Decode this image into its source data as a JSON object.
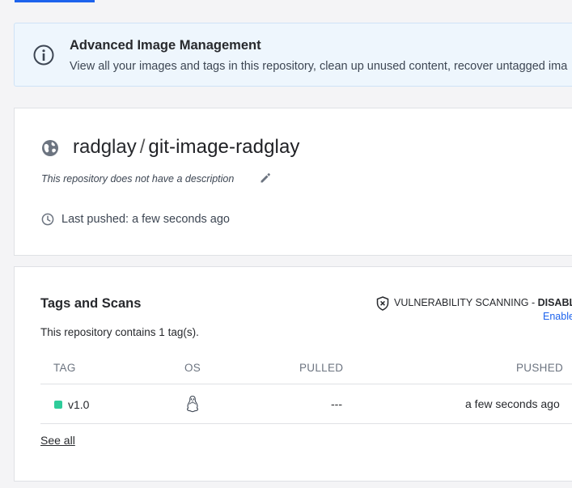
{
  "banner": {
    "title": "Advanced Image Management",
    "description": "View all your images and tags in this repository, clean up unused content, recover untagged ima",
    "icon": "info-icon"
  },
  "repo": {
    "namespace": "radglay",
    "separator": "/",
    "name": "git-image-radglay",
    "description": "This repository does not have a description",
    "last_pushed": "Last pushed: a few seconds ago",
    "visibility_icon": "globe-icon"
  },
  "tags": {
    "title": "Tags and Scans",
    "scanning_label": "VULNERABILITY SCANNING - ",
    "scanning_status": "DISABLED",
    "enable_label": "Enable",
    "count_text": "This repository contains 1 tag(s).",
    "columns": {
      "tag": "TAG",
      "os": "OS",
      "pulled": "PULLED",
      "pushed": "PUSHED"
    },
    "rows": [
      {
        "tag": "v1.0",
        "os": "linux",
        "pulled": "---",
        "pushed": "a few seconds ago",
        "status_color": "#2ecc9a"
      }
    ],
    "see_all": "See all"
  },
  "colors": {
    "accent": "#1d63ed",
    "banner_bg": "#eef6fd",
    "status_active": "#2ecc9a"
  }
}
